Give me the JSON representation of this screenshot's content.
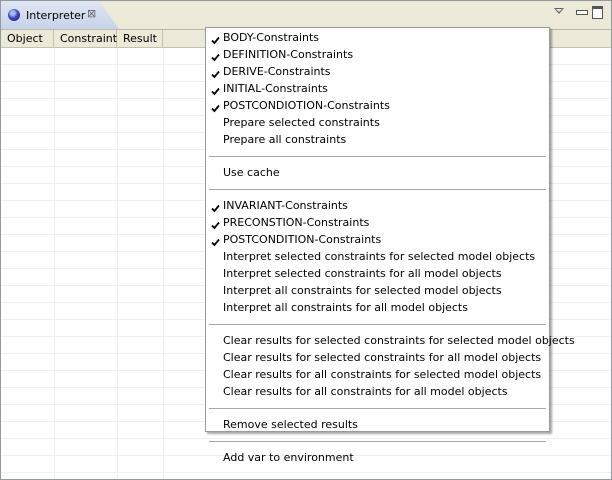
{
  "view": {
    "tab_label": "Interpreter",
    "close_glyph": "⊠",
    "columns": [
      "Object",
      "Constraint",
      "Result"
    ]
  },
  "menu": {
    "groups": [
      {
        "items": [
          {
            "label": "BODY-Constraints",
            "checked": true
          },
          {
            "label": "DEFINITION-Constraints",
            "checked": true
          },
          {
            "label": "DERIVE-Constraints",
            "checked": true
          },
          {
            "label": "INITIAL-Constraints",
            "checked": true
          },
          {
            "label": "POSTCONDIOTION-Constraints",
            "checked": true
          },
          {
            "label": "Prepare selected constraints",
            "checked": false
          },
          {
            "label": "Prepare all constraints",
            "checked": false
          }
        ]
      },
      {
        "items": [
          {
            "label": "Use cache",
            "checked": false
          }
        ]
      },
      {
        "items": [
          {
            "label": "INVARIANT-Constraints",
            "checked": true
          },
          {
            "label": "PRECONSTION-Constraints",
            "checked": true
          },
          {
            "label": "POSTCONDITION-Constraints",
            "checked": true
          },
          {
            "label": "Interpret selected constraints for selected model objects",
            "checked": false
          },
          {
            "label": "Interpret selected constraints for all model objects",
            "checked": false
          },
          {
            "label": "Interpret all constraints for selected model objects",
            "checked": false
          },
          {
            "label": "Interpret all constraints for all model objects",
            "checked": false
          }
        ]
      },
      {
        "items": [
          {
            "label": "Clear results for selected constraints for selected model objects",
            "checked": false
          },
          {
            "label": "Clear results for selected constraints for all model objects",
            "checked": false
          },
          {
            "label": "Clear results for all constraints for selected model objects",
            "checked": false
          },
          {
            "label": "Clear results for all constraints for all model objects",
            "checked": false
          }
        ]
      },
      {
        "items": [
          {
            "label": "Remove selected results",
            "checked": false
          }
        ]
      },
      {
        "items": [
          {
            "label": "Add var to environment",
            "checked": false
          }
        ]
      }
    ]
  }
}
